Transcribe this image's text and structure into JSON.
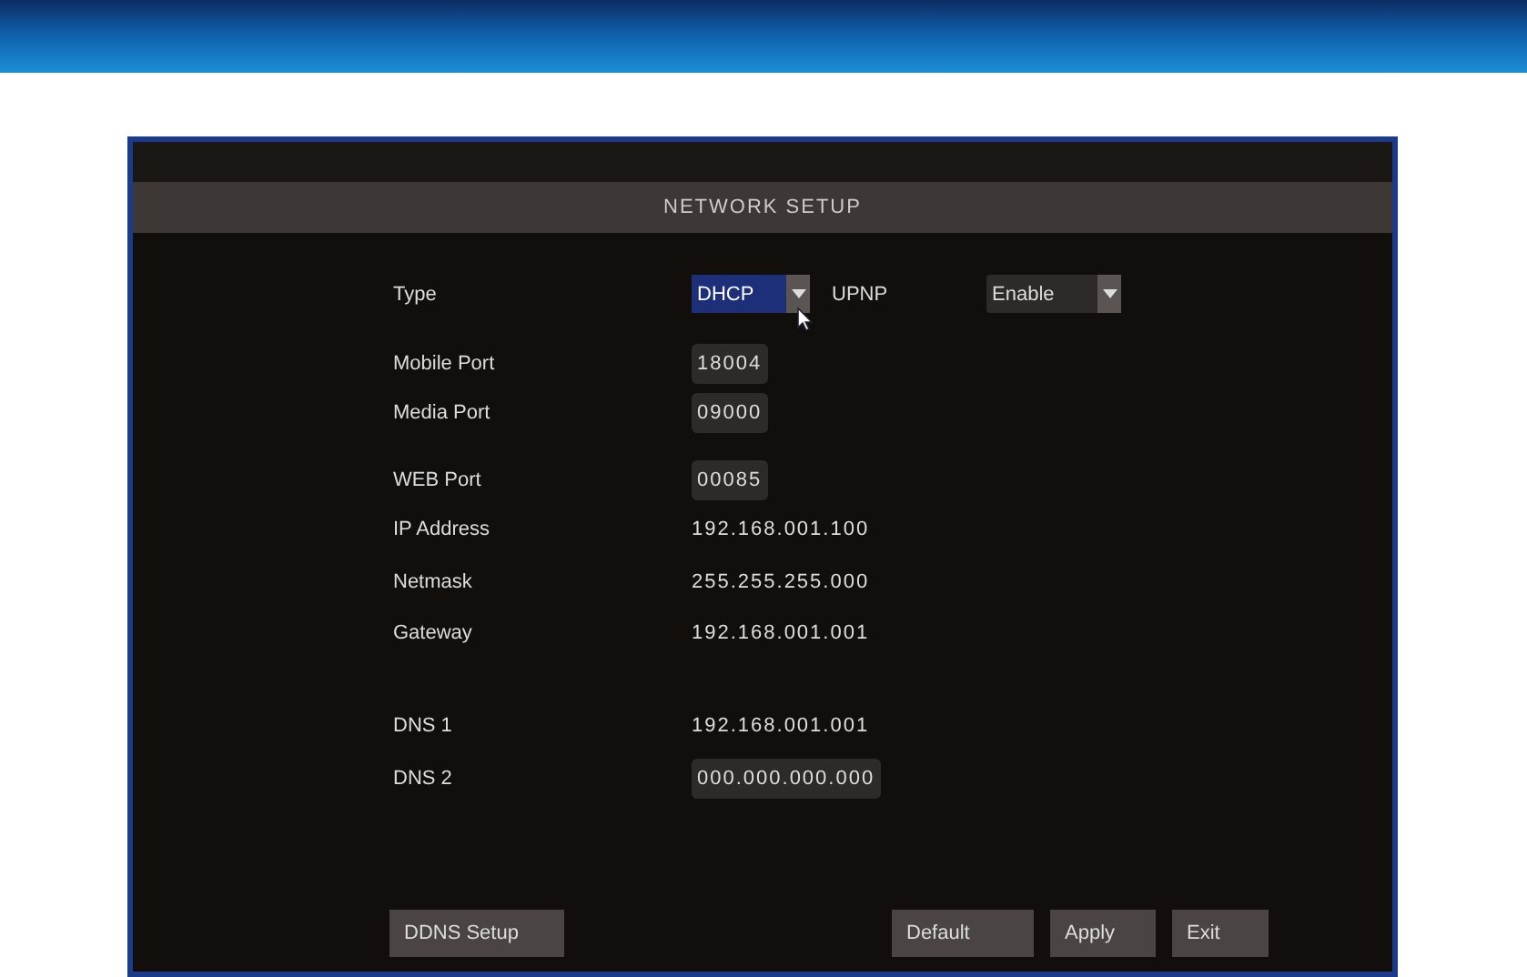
{
  "window": {
    "title": "NETWORK SETUP"
  },
  "fields": [
    {
      "label": "Type",
      "kind": "dropdown",
      "value": "DHCP",
      "focused": true,
      "side": {
        "label": "UPNP",
        "kind": "dropdown",
        "value": "Enable",
        "focused": false
      }
    },
    {
      "label": "Mobile Port",
      "kind": "field",
      "value": "18004",
      "focused": false
    },
    {
      "label": "Media Port",
      "kind": "field",
      "value": "09000",
      "focused": false
    },
    {
      "label": "WEB Port",
      "kind": "field",
      "value": "00085",
      "focused": false
    },
    {
      "label": "IP Address",
      "kind": "text",
      "value": "192.168.001.100",
      "focused": false
    },
    {
      "label": "Netmask",
      "kind": "text",
      "value": "255.255.255.000",
      "focused": false
    },
    {
      "label": "Gateway",
      "kind": "text",
      "value": "192.168.001.001",
      "focused": false
    },
    {
      "label": "DNS 1",
      "kind": "text",
      "value": "192.168.001.001",
      "focused": false
    },
    {
      "label": "DNS 2",
      "kind": "field",
      "value": "000.000.000.000",
      "focused": false
    }
  ],
  "actions_left": [
    "DDNS Setup"
  ],
  "actions_right": [
    "Default",
    "Apply",
    "Exit"
  ]
}
